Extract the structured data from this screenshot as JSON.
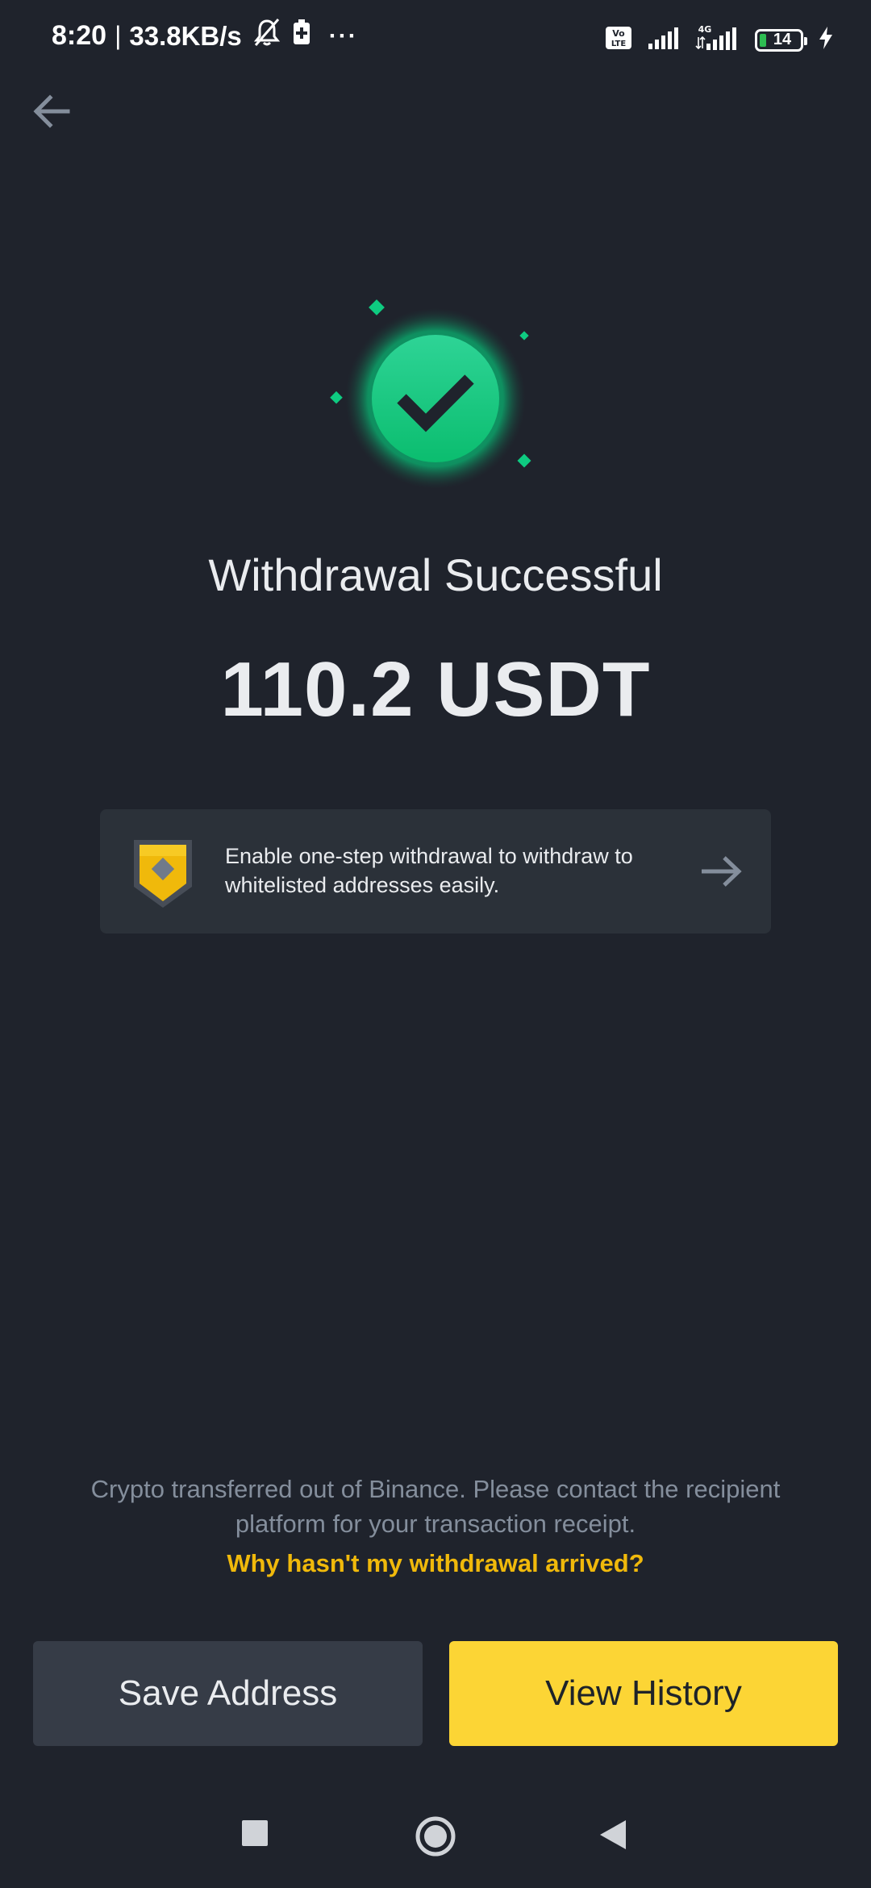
{
  "status_bar": {
    "time": "8:20",
    "separator": "|",
    "speed": "33.8KB/s",
    "more": "···",
    "network_type_1": "Vo LTE",
    "network_type_2": "4G",
    "battery_level": "14",
    "battery_color": "#2ebd52"
  },
  "header": {
    "back_icon": "arrow-left-icon"
  },
  "result": {
    "icon": "check-circle-icon",
    "title": "Withdrawal Successful",
    "amount": "110.2 USDT",
    "accent_color": "#0ecb81"
  },
  "promo": {
    "icon": "shield-icon",
    "text": "Enable one-step withdrawal to withdraw to whitelisted addresses easily.",
    "arrow_icon": "arrow-right-icon"
  },
  "footer": {
    "note": "Crypto transferred out of Binance. Please contact the recipient platform for your transaction receipt.",
    "help_link": "Why hasn't my withdrawal arrived?",
    "link_color": "#f0b90b"
  },
  "actions": {
    "save_label": "Save Address",
    "history_label": "View History",
    "primary_color": "#fcd535"
  },
  "system_nav": {
    "recents_icon": "square-icon",
    "home_icon": "circle-icon",
    "back_icon": "triangle-back-icon"
  }
}
